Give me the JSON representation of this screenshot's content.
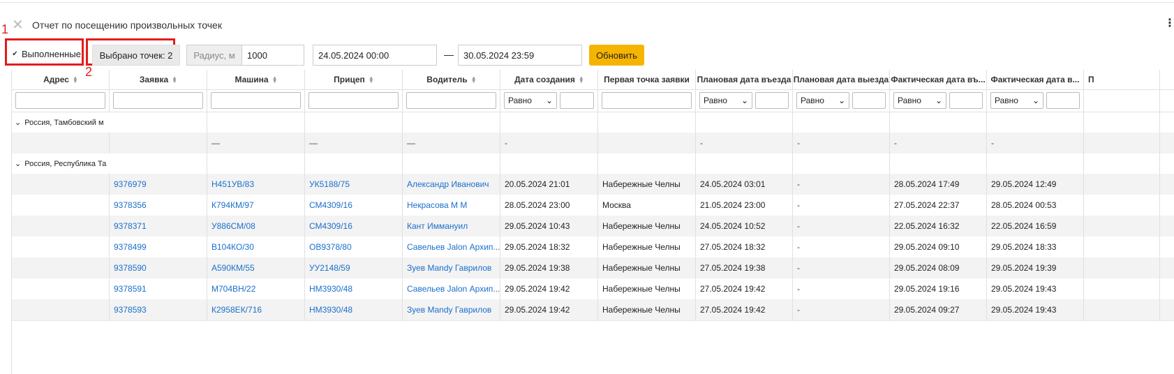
{
  "header": {
    "title": "Отчет по посещению произвольных точек",
    "close_icon": "close-icon",
    "menu_icon": "kebab-menu-icon"
  },
  "annotations": {
    "one": "1",
    "two": "2"
  },
  "toolbar": {
    "completed_label": "Выполненные",
    "completed_checked": true,
    "selected_points": "Выбрано точек: 2",
    "radius_label": "Радиус, м",
    "radius_value": "1000",
    "date_from": "24.05.2024 00:00",
    "date_dash": "—",
    "date_to": "30.05.2024 23:59",
    "refresh_label": "Обновить",
    "accent_color": "#f5b400",
    "annotation_color": "#e41b1b"
  },
  "grid": {
    "columns": [
      "Адрес",
      "Заявка",
      "Машина",
      "Прицеп",
      "Водитель",
      "Дата создания",
      "Первая точка заявки",
      "Плановая дата въезда",
      "Плановая дата выезда",
      "Фактическая дата въ...",
      "Фактическая дата в...",
      "П"
    ],
    "filter_operator": "Равно",
    "groups": [
      {
        "label": "Россия, Тамбовский м",
        "rows": [
          [
            "",
            "",
            "—",
            "—",
            "—",
            "-",
            "",
            "-",
            "-",
            "-",
            "-",
            ""
          ]
        ]
      },
      {
        "label": "Россия, Республика Та",
        "rows": [
          [
            "",
            "9376979",
            "Н451УВ/83",
            "УК5188/75",
            "Александр Иванович",
            "20.05.2024 21:01",
            "Набережные Челны",
            "24.05.2024 03:01",
            "-",
            "28.05.2024 17:49",
            "29.05.2024 12:49",
            ""
          ],
          [
            "",
            "9378356",
            "К794КМ/97",
            "СМ4309/16",
            "Некрасова М М",
            "28.05.2024 23:00",
            "Москва",
            "21.05.2024 23:00",
            "-",
            "27.05.2024 22:37",
            "28.05.2024 00:53",
            ""
          ],
          [
            "",
            "9378371",
            "У886СМ/08",
            "СМ4309/16",
            "Кант Иммануил",
            "29.05.2024 10:43",
            "Набережные Челны",
            "24.05.2024 10:52",
            "-",
            "22.05.2024 16:32",
            "22.05.2024 16:59",
            ""
          ],
          [
            "",
            "9378499",
            "В104КО/30",
            "ОВ9378/80",
            "Савельев Jalon Архип...",
            "29.05.2024 18:32",
            "Набережные Челны",
            "27.05.2024 18:32",
            "-",
            "29.05.2024 09:10",
            "29.05.2024 18:33",
            ""
          ],
          [
            "",
            "9378590",
            "А590КМ/55",
            "УУ2148/59",
            "Зуев Mandy Гаврилов",
            "29.05.2024 19:38",
            "Набережные Челны",
            "27.05.2024 19:38",
            "-",
            "29.05.2024 08:09",
            "29.05.2024 19:39",
            ""
          ],
          [
            "",
            "9378591",
            "М704ВН/22",
            "НМ3930/48",
            "Савельев Jalon Архип...",
            "29.05.2024 19:42",
            "Набережные Челны",
            "27.05.2024 19:42",
            "-",
            "29.05.2024 19:16",
            "29.05.2024 19:43",
            ""
          ],
          [
            "",
            "9378593",
            "К2958ЕК/716",
            "НМ3930/48",
            "Зуев Mandy Гаврилов",
            "29.05.2024 19:42",
            "Набережные Челны",
            "27.05.2024 19:42",
            "-",
            "29.05.2024 09:27",
            "29.05.2024 19:43",
            ""
          ]
        ]
      }
    ]
  }
}
